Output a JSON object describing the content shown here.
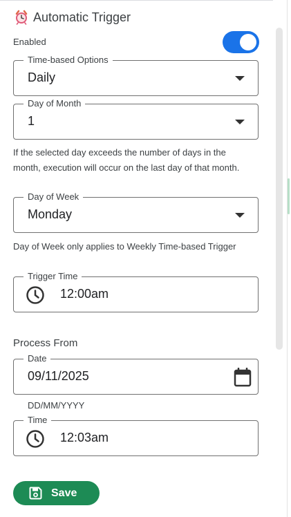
{
  "header": {
    "title": "Automatic Trigger",
    "icon": "alarm-clock-icon"
  },
  "enabled": {
    "label": "Enabled",
    "value": true,
    "accent": "#1a73e8"
  },
  "time_based": {
    "label": "Time-based Options",
    "value": "Daily"
  },
  "day_of_month": {
    "label": "Day of Month",
    "value": "1",
    "help": "If the selected day exceeds the number of days in the month, execution will occur on the last day of that month."
  },
  "day_of_week": {
    "label": "Day of Week",
    "value": "Monday",
    "help": "Day of Week only applies to Weekly Time-based Trigger"
  },
  "trigger_time": {
    "label": "Trigger Time",
    "value": "12:00am",
    "icon": "clock-icon"
  },
  "process_from": {
    "title": "Process From",
    "date": {
      "label": "Date",
      "value": "09/11/2025",
      "hint": "DD/MM/YYYY",
      "icon": "calendar-icon"
    },
    "time": {
      "label": "Time",
      "value": "12:03am",
      "icon": "clock-icon"
    }
  },
  "save_button": {
    "label": "Save",
    "color": "#1d8b55",
    "icon": "save-icon"
  }
}
